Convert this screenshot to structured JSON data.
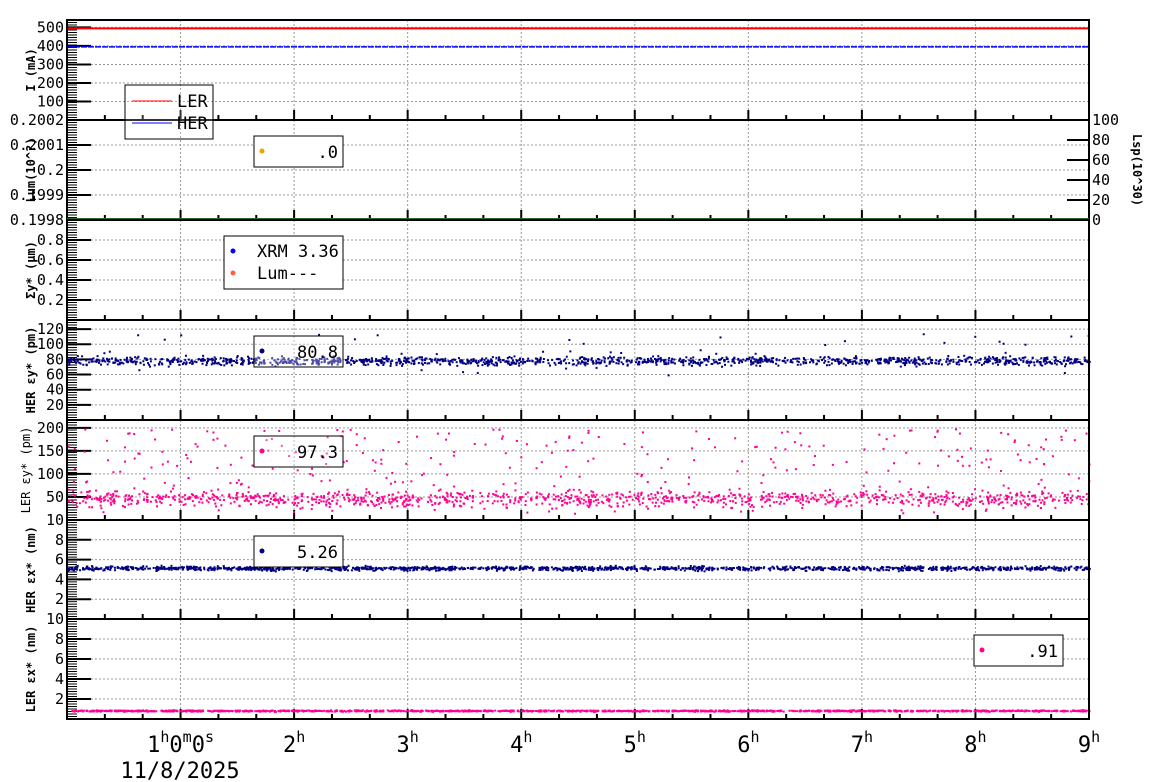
{
  "chart_data": [
    {
      "id": "current",
      "type": "line",
      "ylabel": "I (mA)",
      "ylim": [
        0,
        540
      ],
      "ticks": [
        "100",
        "200",
        "300",
        "400",
        "500"
      ],
      "tickvals": [
        100,
        200,
        300,
        400,
        500
      ],
      "series": [
        {
          "name": "LER",
          "color": "#ff0000",
          "mean": 495,
          "spread": 1
        },
        {
          "name": "HER",
          "color": "#0000ff",
          "mean": 395,
          "spread": 1
        }
      ],
      "legend": {
        "entries": [
          "LER",
          "HER"
        ]
      }
    },
    {
      "id": "lum",
      "type": "scatter",
      "ylabel": "Lum(10^?)",
      "ylim": [
        0.1998,
        0.2002
      ],
      "ticks": [
        "0.1998",
        "0.1999",
        "0.2",
        "0.2001",
        "0.2002"
      ],
      "tickvals": [
        0.1998,
        0.1999,
        0.2,
        0.2001,
        0.2002
      ],
      "right_axis": {
        "label": "Lsp(10^30)",
        "ylim": [
          0,
          100
        ],
        "ticks": [
          "0",
          "20",
          "40",
          "60",
          "80",
          "100"
        ],
        "tickvals": [
          0,
          20,
          40,
          60,
          80,
          100
        ]
      },
      "legend_value": ".0",
      "legend_color": "#f0a000"
    },
    {
      "id": "sigma_y",
      "type": "scatter",
      "ylabel": "Σy* (μm)",
      "ylim": [
        0,
        1
      ],
      "ticks": [
        "0.2",
        "0.4",
        "0.6",
        "0.8"
      ],
      "tickvals": [
        0.2,
        0.4,
        0.6,
        0.8
      ],
      "legend": {
        "entries": [
          {
            "label": "XRM 3.36",
            "color": "#0000ff"
          },
          {
            "label": "Lum---",
            "color": "#ff6040"
          }
        ]
      }
    },
    {
      "id": "her_ey",
      "type": "scatter",
      "ylabel": "HER εy* (pm)",
      "ylim": [
        0,
        132
      ],
      "ticks": [
        "20",
        "40",
        "60",
        "80",
        "100",
        "120"
      ],
      "tickvals": [
        20,
        40,
        60,
        80,
        100,
        120
      ],
      "series": [
        {
          "name": "HER εy",
          "color": "#000080",
          "mean": 79,
          "spread": 4,
          "outliers": [
            60,
            115
          ]
        }
      ],
      "legend_value": "80.8"
    },
    {
      "id": "ler_ey",
      "type": "scatter",
      "ylabel": "LER εy* (pm)",
      "ylim": [
        0,
        217
      ],
      "ticks": [
        "50",
        "100",
        "150",
        "200"
      ],
      "tickvals": [
        50,
        100,
        150,
        200
      ],
      "series": [
        {
          "name": "LER εy",
          "color": "#ff0090",
          "mean": 48,
          "spread": 12,
          "outliers": [
            15,
            200
          ]
        }
      ],
      "legend_value": "97.3"
    },
    {
      "id": "her_ex",
      "type": "scatter",
      "ylabel": "HER εx* (nm)",
      "ylim": [
        0,
        10
      ],
      "ticks": [
        "2",
        "4",
        "6",
        "8",
        "10"
      ],
      "tickvals": [
        2,
        4,
        6,
        8,
        10
      ],
      "series": [
        {
          "name": "HER εx",
          "color": "#000080",
          "mean": 5.2,
          "spread": 0.15
        }
      ],
      "legend_value": "5.26"
    },
    {
      "id": "ler_ex",
      "type": "scatter",
      "ylabel": "LER εx* (nm)",
      "ylim": [
        0,
        10
      ],
      "ticks": [
        "2",
        "4",
        "6",
        "8",
        "10"
      ],
      "tickvals": [
        2,
        4,
        6,
        8,
        10
      ],
      "series": [
        {
          "name": "LER εx",
          "color": "#ff0090",
          "mean": 0.9,
          "spread": 0.05
        }
      ],
      "legend_value": ".91"
    }
  ],
  "xaxis": {
    "xlim_hours": [
      0,
      9
    ],
    "ticks": [
      {
        "h": 1,
        "label": "1",
        "sup": "h",
        "extra": "0",
        "sup2": "m",
        "extra2": "0",
        "sup3": "s"
      },
      {
        "h": 2,
        "label": "2"
      },
      {
        "h": 3,
        "label": "3"
      },
      {
        "h": 4,
        "label": "4"
      },
      {
        "h": 5,
        "label": "5"
      },
      {
        "h": 6,
        "label": "6"
      },
      {
        "h": 7,
        "label": "7"
      },
      {
        "h": 8,
        "label": "8"
      },
      {
        "h": 9,
        "label": "9"
      }
    ],
    "date": "11/8/2025"
  }
}
